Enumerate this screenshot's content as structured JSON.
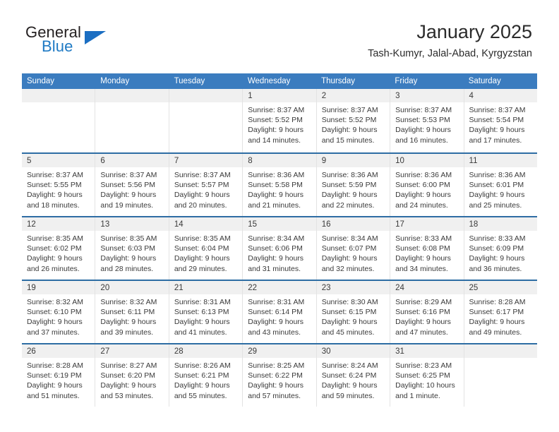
{
  "brand": {
    "word_general": "General",
    "word_blue": "Blue",
    "flag_color": "#1b6ec2"
  },
  "header": {
    "month_title": "January 2025",
    "location": "Tash-Kumyr, Jalal-Abad, Kyrgyzstan"
  },
  "theme": {
    "header_blue": "#3b7cbf",
    "row_rule_blue": "#2e6da4",
    "day_band_gray": "#f0f0f0",
    "text_color": "#3a3a3a"
  },
  "weekdays": [
    "Sunday",
    "Monday",
    "Tuesday",
    "Wednesday",
    "Thursday",
    "Friday",
    "Saturday"
  ],
  "weeks": [
    [
      {
        "day": "",
        "empty": true
      },
      {
        "day": "",
        "empty": true
      },
      {
        "day": "",
        "empty": true
      },
      {
        "day": "1",
        "sunrise": "Sunrise: 8:37 AM",
        "sunset": "Sunset: 5:52 PM",
        "daylight1": "Daylight: 9 hours",
        "daylight2": "and 14 minutes."
      },
      {
        "day": "2",
        "sunrise": "Sunrise: 8:37 AM",
        "sunset": "Sunset: 5:52 PM",
        "daylight1": "Daylight: 9 hours",
        "daylight2": "and 15 minutes."
      },
      {
        "day": "3",
        "sunrise": "Sunrise: 8:37 AM",
        "sunset": "Sunset: 5:53 PM",
        "daylight1": "Daylight: 9 hours",
        "daylight2": "and 16 minutes."
      },
      {
        "day": "4",
        "sunrise": "Sunrise: 8:37 AM",
        "sunset": "Sunset: 5:54 PM",
        "daylight1": "Daylight: 9 hours",
        "daylight2": "and 17 minutes."
      }
    ],
    [
      {
        "day": "5",
        "sunrise": "Sunrise: 8:37 AM",
        "sunset": "Sunset: 5:55 PM",
        "daylight1": "Daylight: 9 hours",
        "daylight2": "and 18 minutes."
      },
      {
        "day": "6",
        "sunrise": "Sunrise: 8:37 AM",
        "sunset": "Sunset: 5:56 PM",
        "daylight1": "Daylight: 9 hours",
        "daylight2": "and 19 minutes."
      },
      {
        "day": "7",
        "sunrise": "Sunrise: 8:37 AM",
        "sunset": "Sunset: 5:57 PM",
        "daylight1": "Daylight: 9 hours",
        "daylight2": "and 20 minutes."
      },
      {
        "day": "8",
        "sunrise": "Sunrise: 8:36 AM",
        "sunset": "Sunset: 5:58 PM",
        "daylight1": "Daylight: 9 hours",
        "daylight2": "and 21 minutes."
      },
      {
        "day": "9",
        "sunrise": "Sunrise: 8:36 AM",
        "sunset": "Sunset: 5:59 PM",
        "daylight1": "Daylight: 9 hours",
        "daylight2": "and 22 minutes."
      },
      {
        "day": "10",
        "sunrise": "Sunrise: 8:36 AM",
        "sunset": "Sunset: 6:00 PM",
        "daylight1": "Daylight: 9 hours",
        "daylight2": "and 24 minutes."
      },
      {
        "day": "11",
        "sunrise": "Sunrise: 8:36 AM",
        "sunset": "Sunset: 6:01 PM",
        "daylight1": "Daylight: 9 hours",
        "daylight2": "and 25 minutes."
      }
    ],
    [
      {
        "day": "12",
        "sunrise": "Sunrise: 8:35 AM",
        "sunset": "Sunset: 6:02 PM",
        "daylight1": "Daylight: 9 hours",
        "daylight2": "and 26 minutes."
      },
      {
        "day": "13",
        "sunrise": "Sunrise: 8:35 AM",
        "sunset": "Sunset: 6:03 PM",
        "daylight1": "Daylight: 9 hours",
        "daylight2": "and 28 minutes."
      },
      {
        "day": "14",
        "sunrise": "Sunrise: 8:35 AM",
        "sunset": "Sunset: 6:04 PM",
        "daylight1": "Daylight: 9 hours",
        "daylight2": "and 29 minutes."
      },
      {
        "day": "15",
        "sunrise": "Sunrise: 8:34 AM",
        "sunset": "Sunset: 6:06 PM",
        "daylight1": "Daylight: 9 hours",
        "daylight2": "and 31 minutes."
      },
      {
        "day": "16",
        "sunrise": "Sunrise: 8:34 AM",
        "sunset": "Sunset: 6:07 PM",
        "daylight1": "Daylight: 9 hours",
        "daylight2": "and 32 minutes."
      },
      {
        "day": "17",
        "sunrise": "Sunrise: 8:33 AM",
        "sunset": "Sunset: 6:08 PM",
        "daylight1": "Daylight: 9 hours",
        "daylight2": "and 34 minutes."
      },
      {
        "day": "18",
        "sunrise": "Sunrise: 8:33 AM",
        "sunset": "Sunset: 6:09 PM",
        "daylight1": "Daylight: 9 hours",
        "daylight2": "and 36 minutes."
      }
    ],
    [
      {
        "day": "19",
        "sunrise": "Sunrise: 8:32 AM",
        "sunset": "Sunset: 6:10 PM",
        "daylight1": "Daylight: 9 hours",
        "daylight2": "and 37 minutes."
      },
      {
        "day": "20",
        "sunrise": "Sunrise: 8:32 AM",
        "sunset": "Sunset: 6:11 PM",
        "daylight1": "Daylight: 9 hours",
        "daylight2": "and 39 minutes."
      },
      {
        "day": "21",
        "sunrise": "Sunrise: 8:31 AM",
        "sunset": "Sunset: 6:13 PM",
        "daylight1": "Daylight: 9 hours",
        "daylight2": "and 41 minutes."
      },
      {
        "day": "22",
        "sunrise": "Sunrise: 8:31 AM",
        "sunset": "Sunset: 6:14 PM",
        "daylight1": "Daylight: 9 hours",
        "daylight2": "and 43 minutes."
      },
      {
        "day": "23",
        "sunrise": "Sunrise: 8:30 AM",
        "sunset": "Sunset: 6:15 PM",
        "daylight1": "Daylight: 9 hours",
        "daylight2": "and 45 minutes."
      },
      {
        "day": "24",
        "sunrise": "Sunrise: 8:29 AM",
        "sunset": "Sunset: 6:16 PM",
        "daylight1": "Daylight: 9 hours",
        "daylight2": "and 47 minutes."
      },
      {
        "day": "25",
        "sunrise": "Sunrise: 8:28 AM",
        "sunset": "Sunset: 6:17 PM",
        "daylight1": "Daylight: 9 hours",
        "daylight2": "and 49 minutes."
      }
    ],
    [
      {
        "day": "26",
        "sunrise": "Sunrise: 8:28 AM",
        "sunset": "Sunset: 6:19 PM",
        "daylight1": "Daylight: 9 hours",
        "daylight2": "and 51 minutes."
      },
      {
        "day": "27",
        "sunrise": "Sunrise: 8:27 AM",
        "sunset": "Sunset: 6:20 PM",
        "daylight1": "Daylight: 9 hours",
        "daylight2": "and 53 minutes."
      },
      {
        "day": "28",
        "sunrise": "Sunrise: 8:26 AM",
        "sunset": "Sunset: 6:21 PM",
        "daylight1": "Daylight: 9 hours",
        "daylight2": "and 55 minutes."
      },
      {
        "day": "29",
        "sunrise": "Sunrise: 8:25 AM",
        "sunset": "Sunset: 6:22 PM",
        "daylight1": "Daylight: 9 hours",
        "daylight2": "and 57 minutes."
      },
      {
        "day": "30",
        "sunrise": "Sunrise: 8:24 AM",
        "sunset": "Sunset: 6:24 PM",
        "daylight1": "Daylight: 9 hours",
        "daylight2": "and 59 minutes."
      },
      {
        "day": "31",
        "sunrise": "Sunrise: 8:23 AM",
        "sunset": "Sunset: 6:25 PM",
        "daylight1": "Daylight: 10 hours",
        "daylight2": "and 1 minute."
      },
      {
        "day": "",
        "empty": true
      }
    ]
  ]
}
